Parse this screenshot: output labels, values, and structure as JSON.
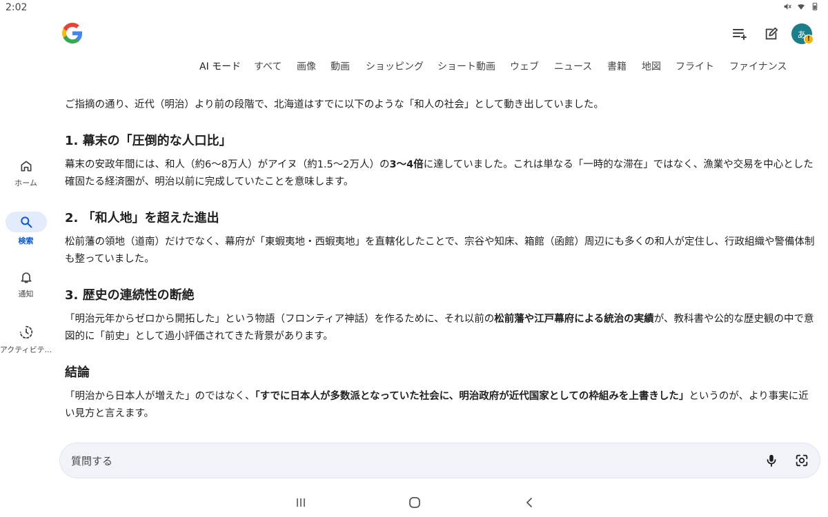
{
  "status_bar": {
    "time": "2:02"
  },
  "header": {
    "avatar_initial": "あ",
    "avatar_badge": "!"
  },
  "tabs": [
    "AI モード",
    "すべて",
    "画像",
    "動画",
    "ショッピング",
    "ショート動画",
    "ウェブ",
    "ニュース",
    "書籍",
    "地図",
    "フライト",
    "ファイナンス"
  ],
  "rail": {
    "home": "ホーム",
    "search": "検索",
    "notifications": "通知",
    "activity": "アクティビテ..."
  },
  "content": {
    "intro": "ご指摘の通り、近代（明治）より前の段階で、北海道はすでに以下のような「和人の社会」として動き出していました。",
    "s1_heading": "1. 幕末の「圧倒的な人口比」",
    "s1_a": "幕末の安政年間には、和人（約6〜8万人）がアイヌ（約1.5〜2万人）の",
    "s1_bold": "3〜4倍",
    "s1_b": "に達していました。これは単なる「一時的な滞在」ではなく、漁業や交易を中心とした確固たる経済圏が、明治以前に完成していたことを意味します。",
    "s2_heading": "2. 「和人地」を超えた進出",
    "s2_text": "松前藩の領地（道南）だけでなく、幕府が「東蝦夷地・西蝦夷地」を直轄化したことで、宗谷や知床、箱館（函館）周辺にも多くの和人が定住し、行政組織や警備体制も整っていました。",
    "s3_heading": "3. 歴史の連続性の断絶",
    "s3_a": "「明治元年からゼロから開拓した」という物語（フロンティア神話）を作るために、それ以前の",
    "s3_bold": "松前藩や江戸幕府による統治の実績",
    "s3_b": "が、教科書や公的な歴史観の中で意図的に「前史」として過小評価されてきた背景があります。",
    "s4_heading": "結論",
    "s4_a": "「明治から日本人が増えた」のではなく、",
    "s4_bold": "「すでに日本人が多数派となっていた社会に、明治政府が近代国家としての枠組みを上書きした」",
    "s4_b": "というのが、より事実に近い見方と言えます。"
  },
  "ask": {
    "placeholder": "質問する"
  },
  "colors": {
    "accent": "#0b57d0",
    "pill": "#e3ecfb",
    "avatar": "#1a7f8a",
    "warn": "#f4b400",
    "input_bg": "#f0f4f9"
  }
}
